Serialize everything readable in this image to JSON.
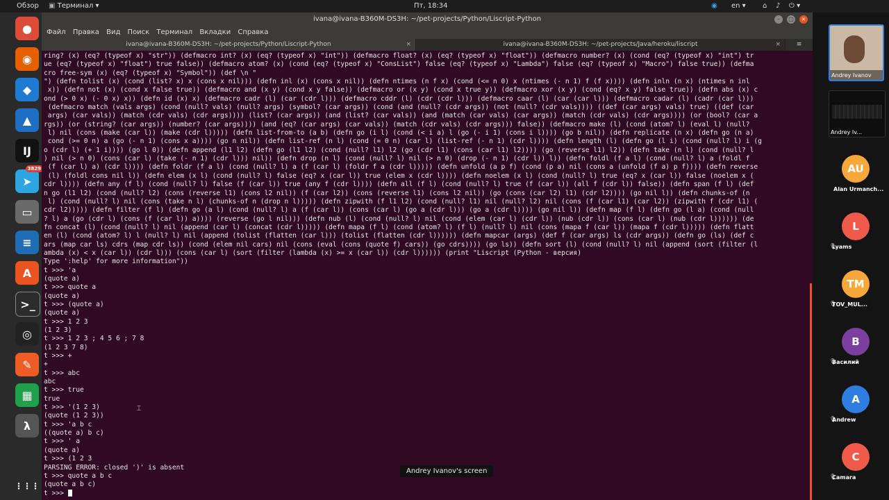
{
  "topbar": {
    "overview": "Обзор",
    "app_menu": "Терминал ▾",
    "clock": "Пт, 18:34",
    "lang": "en ▾"
  },
  "dock": {
    "jitsi_label": "jitsi",
    "telegram_badge": "3829",
    "apps": [
      {
        "name": "chrome",
        "glyph": "●",
        "color": "#dd4b39"
      },
      {
        "name": "firefox",
        "glyph": "◉",
        "color": "#e66000"
      },
      {
        "name": "vscode",
        "glyph": "◆",
        "color": "#1f7bd1"
      },
      {
        "name": "ruby-app",
        "glyph": "▲",
        "color": "#1e6fc4"
      },
      {
        "name": "intellij",
        "glyph": "IJ",
        "color": "#111111"
      },
      {
        "name": "telegram",
        "glyph": "➤",
        "color": "#2ca5e0"
      },
      {
        "name": "files",
        "glyph": "▭",
        "color": "#6a6a6a"
      },
      {
        "name": "libreoffice-writer",
        "glyph": "≡",
        "color": "#1f6db5"
      },
      {
        "name": "software",
        "glyph": "A",
        "color": "#e95420"
      },
      {
        "name": "terminal",
        "glyph": ">_",
        "color": "#2c2c2c"
      },
      {
        "name": "obs",
        "glyph": "◎",
        "color": "#222222"
      },
      {
        "name": "postman",
        "glyph": "✎",
        "color": "#ef5b25"
      },
      {
        "name": "libreoffice-calc",
        "glyph": "▦",
        "color": "#20a04a"
      },
      {
        "name": "lambda",
        "glyph": "λ",
        "color": "#555555"
      }
    ],
    "show_apps": "⋮⋮⋮"
  },
  "terminal": {
    "title": "ivana@ivana-B360M-DS3H: ~/pet-projects/Python/Liscript-Python",
    "menu": [
      "Файл",
      "Правка",
      "Вид",
      "Поиск",
      "Терминал",
      "Вкладки",
      "Справка"
    ],
    "tabs": [
      {
        "label": "ivana@ivana-B360M-DS3H: ~/pet-projects/Python/Liscript-Python",
        "active": true
      },
      {
        "label": "ivana@ivana-B360M-DS3H: ~/pet-projects/Java/heroku/liscript",
        "active": false
      }
    ],
    "lines": [
      "ring? (x) (eq? (typeof x) \"str\")) (defmacro int? (x) (eq? (typeof x) \"int\")) (defmacro float? (x) (eq? (typeof x) \"float\")) (defmacro number? (x) (cond (eq? (typeof x) \"int\") tr",
      "ue (eq? (typeof x) \"float\") true false)) (defmacro atom? (x) (cond (eq? (typeof x) \"ConsList\") false (eq? (typeof x) \"Lambda\") false (eq? (typeof x) \"Macro\") false true)) (defma",
      "cro free-sym (x) (eq? (typeof x) \"Symbol\")) (def \\n \"",
      "\") (defn tolist (x) (cond (list? x) x (cons x nil))) (defn inl (x) (cons x nil)) (defn ntimes (n f x) (cond (<= n 0) x (ntimes (- n 1) f (f x)))) (defn inln (n x) (ntimes n inl",
      " x)) (defn not (x) (cond x false true)) (defmacro and (x y) (cond x y false)) (defmacro or (x y) (cond x true y)) (defmacro xor (x y) (cond (eq? x y) false true)) (defn abs (x) c",
      "ond (> 0 x) (- 0 x) x)) (defn id (x) x) (defmacro cadr (l) (car (cdr l))) (defmacro cddr (l) (cdr (cdr l))) (defmacro caar (l) (car (car l))) (defmacro cadar (l) (cadr (car l)))",
      " (defmacro match (vals args) (cond (null? vals) (null? args) (symbol? (car args)) (cond (and (null? (cdr args)) (not (null? (cdr vals)))) ((def (car args) vals) true) ((def (car",
      " args) (car vals)) (match (cdr vals) (cdr args)))) (list? (car args)) (and (list? (car vals)) (and (match (car vals) (car args)) (match (cdr vals) (cdr args)))) (or (bool? (car a",
      "rgs)) (or (string? (car args)) (number? (car args)))) (and (eq? (car args) (car vals)) (match (cdr vals) (cdr args))) false)) (defmacro make (l) (cond (atom? l) (eval l) (null?",
      " l) nil (cons (make (car l)) (make (cdr l))))) (defn list-from-to (a b) (defn go (i l) (cond (< i a) l (go (- i 1) (cons i l)))) (go b nil)) (defn replicate (n x) (defn go (n a)",
      " cond (>= 0 n) a (go (- n 1) (cons x a)))) (go n nil)) (defn list-ref (n l) (cond (= 0 n) (car l) (list-ref (- n 1) (cdr l)))) (defn length (l) (defn go (l i) (cond (null? l) i (g",
      "o (cdr l) (+ 1 i)))) (go l 0)) (defn append (l1 l2) (defn go (l1 l2) (cond (null? l1) l2 (go (cdr l1) (cons (car l1) l2)))) (go (reverse l1) l2)) (defn take (n l) (cond (null? l",
      ") nil (> n 0) (cons (car l) (take (- n 1) (cdr l))) nil)) (defn drop (n l) (cond (null? l) nil (> n 0) (drop (- n 1) (cdr l)) l)) (defn foldl (f a l) (cond (null? l) a (foldl f",
      " (f (car l) a) (cdr l)))) (defn foldr (f a l) (cond (null? l) a (f (car l) (foldr f a (cdr l))))) (defn unfold (a p f) (cond (p a) nil (cons a (unfold (f a) p f)))) (defn reverse",
      " (l) (foldl cons nil l)) (defn elem (x l) (cond (null? l) false (eq? x (car l)) true (elem x (cdr l)))) (defn noelem (x l) (cond (null? l) true (eq? x (car l)) false (noelem x (",
      "cdr l)))) (defn any (f l) (cond (null? l) false (f (car l)) true (any f (cdr l)))) (defn all (f l) (cond (null? l) true (f (car l)) (all f (cdr l)) false)) (defn span (f l) (def",
      "n go (l1 l2) (cond (null? l2) (cons (reverse l1) (cons l2 nil)) (f (car l2)) (cons (reverse l1) (cons l2 nil)) (go (cons (car l2) l1) (cdr l2)))) (go nil l)) (defn chunks-of (n",
      " l) (cond (null? l) nil (cons (take n l) (chunks-of n (drop n l))))) (defn zipwith (f l1 l2) (cond (null? l1) nil (null? l2) nil (cons (f (car l1) (car l2)) (zipwith f (cdr l1) (",
      "cdr l2))))) (defn filter (f l) (defn go (a l) (cond (null? l) a (f (car l)) (cons (car l) (go a (cdr l))) (go a (cdr l)))) (go nil l)) (defn map (f l) (defn go (l a) (cond (null",
      "? l) a (go (cdr l) (cons (f (car l)) a)))) (reverse (go l nil))) (defn nub (l) (cond (null? l) nil (cond (elem (car l) (cdr l)) (nub (cdr l)) (cons (car l) (nub (cdr l)))))) (de",
      "fn concat (l) (cond (null? l) nil (append (car l) (concat (cdr l))))) (defn mapa (f l) (cond (atom? l) (f l) (null? l) nil (cons (mapa f (car l)) (mapa f (cdr l))))) (defn flatt",
      "en (l) (cond (atom? l) l (null? l) nil (append (tolist (flatten (car l))) (tolist (flatten (cdr l)))))) (defn mapcar (args) (def f (car args) ls (cdr args)) (defn go (ls) (def c",
      "ars (map car ls) cdrs (map cdr ls)) (cond (elem nil cars) nil (cons (eval (cons (quote f) cars)) (go cdrs)))) (go ls)) (defn sort (l) (cond (null? l) nil (append (sort (filter (l",
      "ambda (x) < x (car l)) (cdr l))) (cons (car l) (sort (filter (lambda (x) >= x (car l)) (cdr l)))))) (print \"Liscript (Python - версия)",
      "Type ':help' for more information\"))",
      "t >>> 'a",
      "(quote a)",
      "t >>> quote a",
      "(quote a)",
      "t >>> (quote a)",
      "(quote a)",
      "t >>> 1 2 3",
      "(1 2 3)",
      "t >>> 1 2 3 ; 4 5 6 ; 7 8",
      "(1 2 3 7 8)",
      "t >>> +",
      "+",
      "t >>> abc",
      "abc",
      "t >>> true",
      "true",
      "t >>> '(1 2 3)",
      "(quote (1 2 3))",
      "t >>> 'a b c",
      "((quote a) b c)",
      "t >>> ' a",
      "(quote a)",
      "t >>> (1 2 3",
      "PARSING ERROR: closed ')' is absent",
      "t >>> quote a b c",
      "(quote a b c)"
    ],
    "prompt": "t >>> "
  },
  "screen_share_label": "Andrey Ivanov's screen",
  "participants": {
    "video": [
      {
        "name": "Andrey Ivanov"
      },
      {
        "name": "Andrey Iv..."
      }
    ],
    "avatars": [
      {
        "initials": "AU",
        "name": "Alan Urmanch...",
        "color": "#f6a83b",
        "muted": false
      },
      {
        "initials": "L",
        "name": "Lyams",
        "color": "#f05a4a",
        "muted": true
      },
      {
        "initials": "TM",
        "name": "TOV_MUL...",
        "color": "#f6a83b",
        "muted": true
      },
      {
        "initials": "B",
        "name": "Василий",
        "color": "#7b3fa0",
        "muted": true
      },
      {
        "initials": "A",
        "name": "Andrew",
        "color": "#2e7de0",
        "muted": true
      },
      {
        "initials": "C",
        "name": "Camara",
        "color": "#f05a4a",
        "muted": true
      }
    ]
  }
}
